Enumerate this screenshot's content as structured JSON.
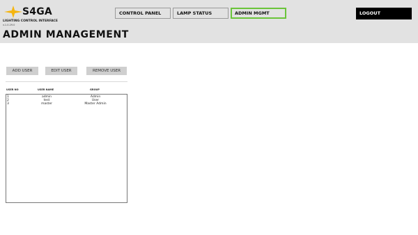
{
  "app": {
    "brand": "S4GA",
    "subtitle": "LIGHTING CONTROL INTERFACE",
    "version": "v.1.0.29.0",
    "logo_color": "#f5b50f"
  },
  "nav": {
    "control_panel": "CONTROL PANEL",
    "lamp_status": "LAMP STATUS",
    "admin_mgmt": "ADMIN MGMT",
    "logout": "LOGOUT",
    "active_border_color": "#6ac43a"
  },
  "page": {
    "title": "ADMIN MANAGEMENT"
  },
  "actions": {
    "add": "ADD USER",
    "edit": "EDIT USER",
    "remove": "REMOVE USER"
  },
  "table": {
    "headers": {
      "no": "USER NO",
      "name": "USER NAME",
      "group": "GROUP"
    },
    "rows": [
      {
        "no": "1",
        "name": "admin",
        "group": "Admin"
      },
      {
        "no": "2",
        "name": "test",
        "group": "User"
      },
      {
        "no": "3",
        "name": "master",
        "group": "Master Admin"
      }
    ]
  }
}
